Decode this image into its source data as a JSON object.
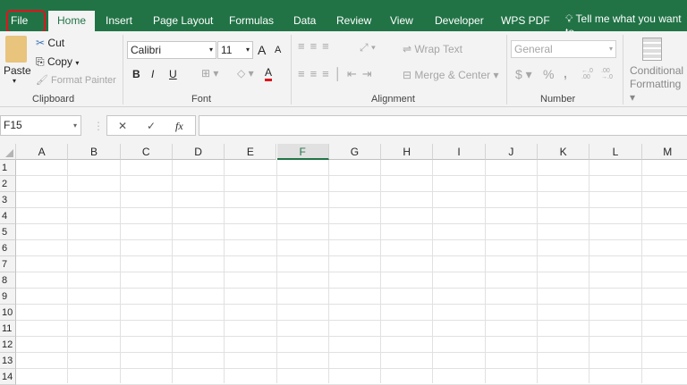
{
  "tabs": [
    "File",
    "Home",
    "Insert",
    "Page Layout",
    "Formulas",
    "Data",
    "Review",
    "View",
    "Developer",
    "WPS PDF"
  ],
  "tell_me": "Tell me what you want to",
  "clipboard": {
    "paste": "Paste",
    "cut": "Cut",
    "copy": "Copy",
    "format_painter": "Format Painter",
    "label": "Clipboard"
  },
  "font": {
    "name": "Calibri",
    "size": "11",
    "bold": "B",
    "italic": "I",
    "underline": "U",
    "color_a": "A",
    "grow": "A",
    "shrink": "A",
    "label": "Font"
  },
  "alignment": {
    "wrap": "Wrap Text",
    "merge": "Merge & Center",
    "label": "Alignment"
  },
  "number": {
    "format": "General",
    "currency": "$",
    "percent": "%",
    "comma": ",",
    "inc": "←.0 .00",
    "dec": ".00 →.0",
    "label": "Number"
  },
  "styles": {
    "conditional": "Conditional",
    "formatting": "Formatting"
  },
  "formula_bar": {
    "name_box": "F15",
    "cancel": "✕",
    "enter": "✓",
    "fx": "fx",
    "value": ""
  },
  "columns": [
    "A",
    "B",
    "C",
    "D",
    "E",
    "F",
    "G",
    "H",
    "I",
    "J",
    "K",
    "L",
    "M"
  ],
  "selected_column": "F",
  "rows": [
    "1",
    "2",
    "3",
    "4",
    "5",
    "6",
    "7",
    "8",
    "9",
    "10",
    "11",
    "12",
    "13",
    "14"
  ],
  "colors": {
    "brand": "#217346",
    "highlight": "#e0141e"
  }
}
